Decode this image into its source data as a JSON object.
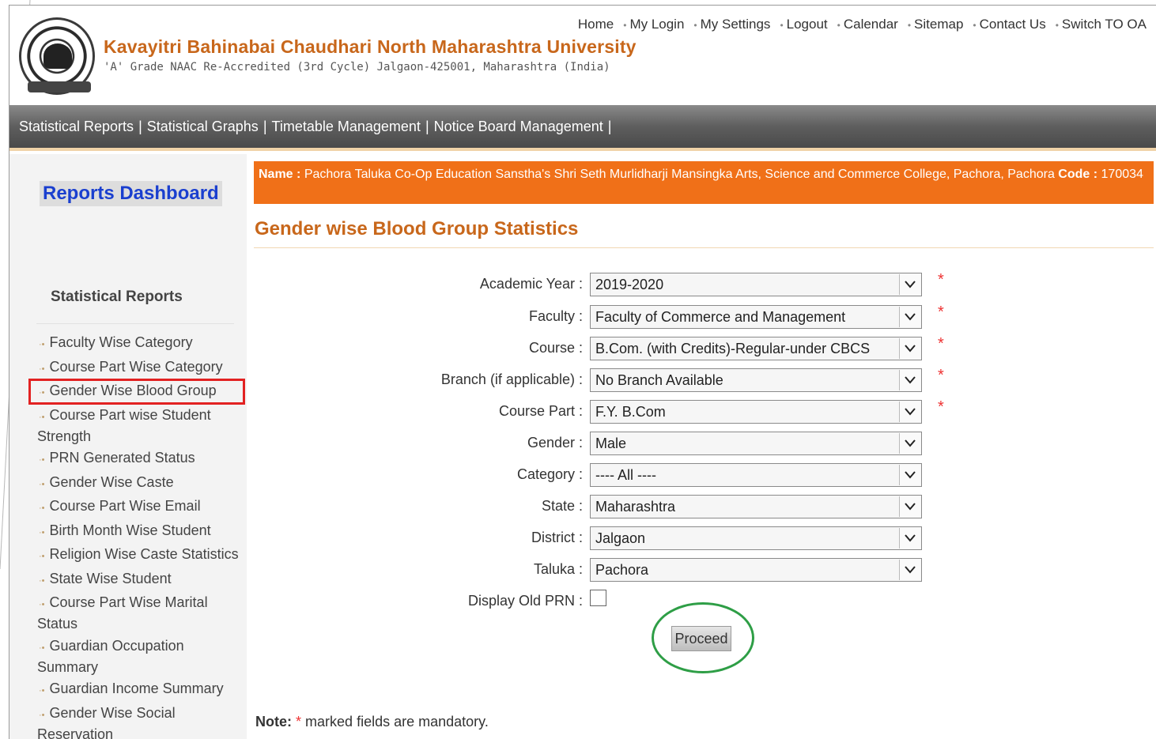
{
  "header": {
    "university_name": "Kavayitri Bahinabai Chaudhari North Maharashtra University",
    "subtitle": "'A' Grade NAAC Re-Accredited (3rd Cycle) Jalgaon-425001, Maharashtra (India)",
    "top_links": [
      "Home",
      "My Login",
      "My Settings",
      "Logout",
      "Calendar",
      "Sitemap",
      "Contact Us",
      "Switch TO OA"
    ]
  },
  "nav": {
    "items": [
      "Statistical Reports",
      "Statistical Graphs",
      "Timetable Management",
      "Notice Board Management"
    ]
  },
  "sidebar": {
    "dashboard_title": "Reports Dashboard",
    "section_title": "Statistical Reports",
    "items": [
      "Faculty Wise Category",
      "Course Part Wise Category",
      "Gender Wise Blood Group",
      "Course Part wise Student Strength",
      "PRN Generated Status",
      "Gender Wise Caste",
      "Course Part Wise  Email",
      "Birth Month Wise Student",
      "Religion Wise Caste Statistics",
      "State Wise Student",
      "Course Part Wise Marital Status",
      "Guardian Occupation Summary",
      "Guardian Income Summary",
      "Gender Wise Social Reservation"
    ],
    "active_index": 2
  },
  "info": {
    "name_label": "Name :",
    "name_value": "Pachora Taluka Co-Op Education Sanstha's Shri Seth Murlidharji Mansingka Arts, Science and Commerce College, Pachora, Pachora",
    "code_label": "Code :",
    "code_value": "170034"
  },
  "page_title": "Gender wise Blood Group Statistics",
  "form": {
    "academic_year_label": "Academic Year :",
    "academic_year_value": "2019-2020",
    "faculty_label": "Faculty :",
    "faculty_value": "Faculty of Commerce and Management",
    "course_label": "Course :",
    "course_value": "B.Com. (with Credits)-Regular-under CBCS",
    "branch_label": "Branch (if applicable) :",
    "branch_value": "No Branch Available",
    "course_part_label": "Course Part :",
    "course_part_value": "F.Y. B.Com",
    "gender_label": "Gender :",
    "gender_value": "Male",
    "category_label": "Category :",
    "category_value": "---- All ----",
    "state_label": "State :",
    "state_value": "Maharashtra",
    "district_label": "District :",
    "district_value": "Jalgaon",
    "taluka_label": "Taluka :",
    "taluka_value": "Pachora",
    "display_old_prn_label": "Display Old PRN :",
    "required_mark": "*",
    "proceed_label": "Proceed"
  },
  "note": {
    "label": "Note:",
    "star": "*",
    "text": "marked fields are mandatory."
  },
  "colors": {
    "accent_orange": "#f07018",
    "title_orange": "#c8671b",
    "dashboard_blue": "#1a3fcf",
    "highlight_red": "#e22222",
    "highlight_green": "#2e9e46"
  }
}
